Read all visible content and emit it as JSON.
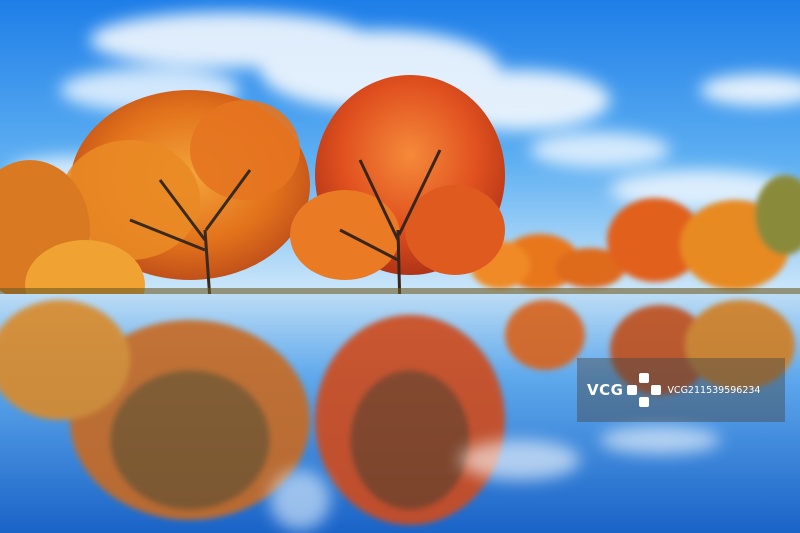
{
  "scene": {
    "description_kind": "photo",
    "colors": {
      "sky_top": "#1f7fe6",
      "sky_mid": "#4aa4f0",
      "sky_horizon": "#bfe0f8",
      "foliage_orange": "#e8741a",
      "foliage_red": "#d9431c",
      "foliage_gold": "#f0a233",
      "water": "#2f86d8"
    }
  },
  "watermark": {
    "brand": "VCG",
    "image_id": "VCG211539596234",
    "icon": "flower-logo-icon"
  }
}
